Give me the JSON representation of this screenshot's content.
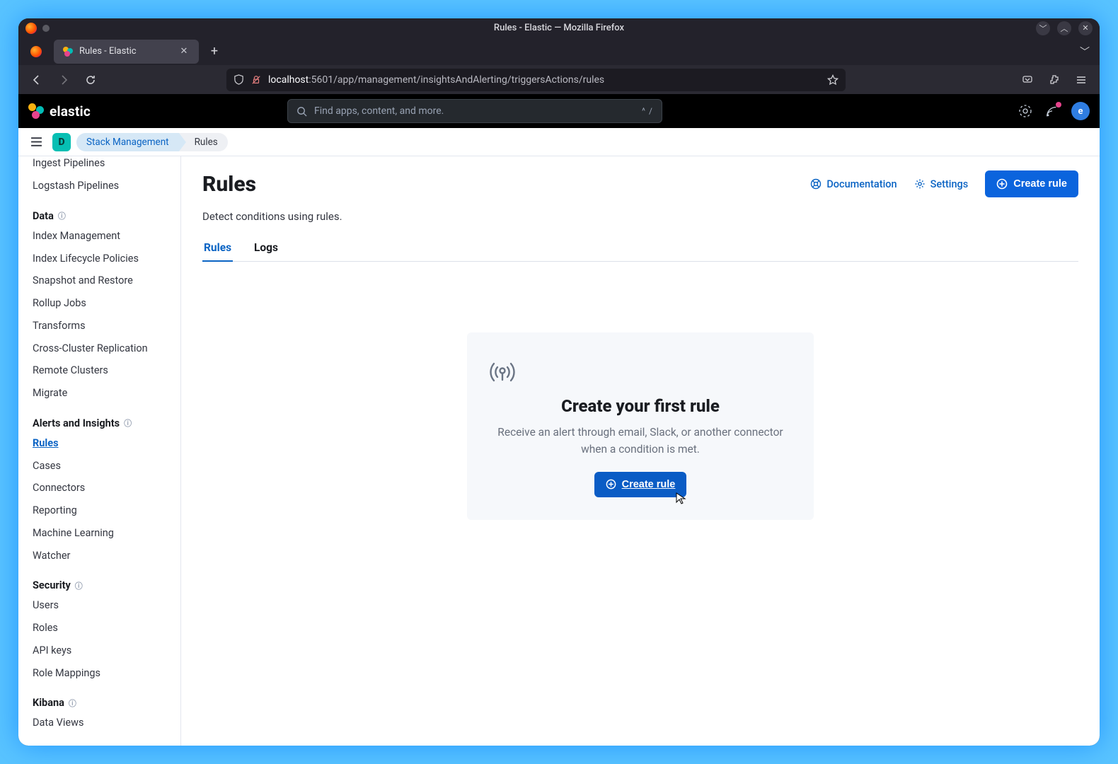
{
  "window": {
    "title": "Rules - Elastic — Mozilla Firefox"
  },
  "browser": {
    "tab_title": "Rules - Elastic",
    "url_host": "localhost",
    "url_port": ":5601",
    "url_path": "/app/management/insightsAndAlerting/triggersActions/rules"
  },
  "header": {
    "brand": "elastic",
    "search_placeholder": "Find apps, content, and more.",
    "search_shortcut": "^ /",
    "avatar_letter": "e"
  },
  "breadcrumb": {
    "space_letter": "D",
    "crumb1": "Stack Management",
    "crumb2": "Rules"
  },
  "sidebar": {
    "top_cut_item": "Ingest Pipelines",
    "top_item2": "Logstash Pipelines",
    "section_data_title": "Data",
    "data_items": [
      "Index Management",
      "Index Lifecycle Policies",
      "Snapshot and Restore",
      "Rollup Jobs",
      "Transforms",
      "Cross-Cluster Replication",
      "Remote Clusters",
      "Migrate"
    ],
    "section_alerts_title": "Alerts and Insights",
    "alerts_items": [
      "Rules",
      "Cases",
      "Connectors",
      "Reporting",
      "Machine Learning",
      "Watcher"
    ],
    "alerts_active_index": 0,
    "section_security_title": "Security",
    "security_items": [
      "Users",
      "Roles",
      "API keys",
      "Role Mappings"
    ],
    "section_kibana_title": "Kibana",
    "kibana_items": [
      "Data Views"
    ]
  },
  "page": {
    "title": "Rules",
    "subtitle": "Detect conditions using rules.",
    "action_documentation": "Documentation",
    "action_settings": "Settings",
    "action_create": "Create rule",
    "tabs": [
      "Rules",
      "Logs"
    ],
    "active_tab_index": 0,
    "empty": {
      "title": "Create your first rule",
      "desc": "Receive an alert through email, Slack, or another connector when a condition is met.",
      "button": "Create rule"
    }
  }
}
